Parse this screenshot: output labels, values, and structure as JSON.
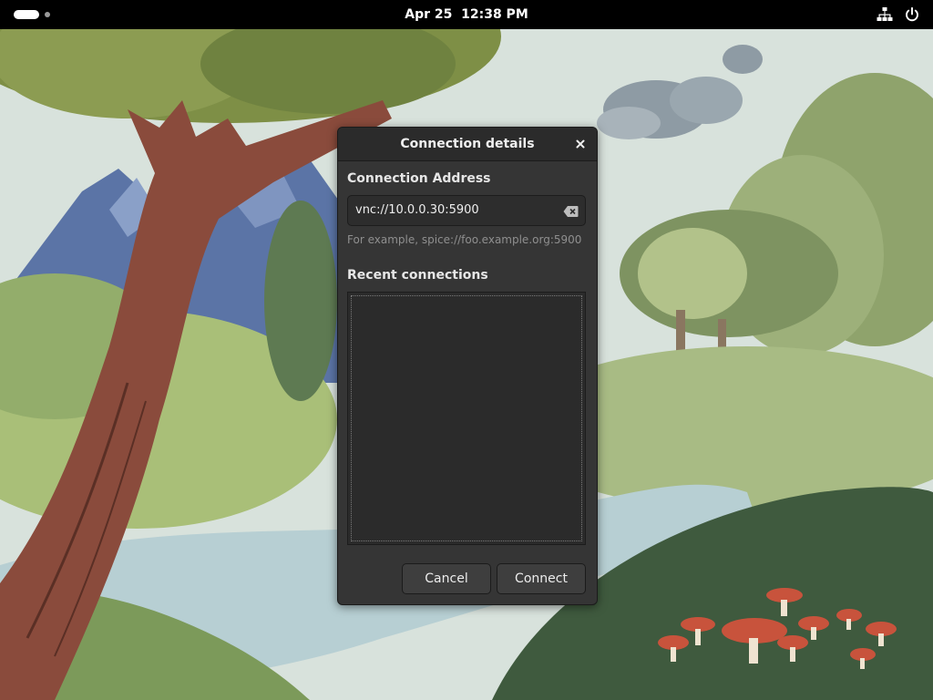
{
  "topbar": {
    "datetime": "Apr 25  12:38 PM",
    "icons": [
      "activities-indicator",
      "network-wired-icon",
      "power-icon"
    ]
  },
  "dialog": {
    "title": "Connection details",
    "address_label": "Connection Address",
    "address_value": "vnc://10.0.0.30:5900",
    "address_hint": "For example, spice://foo.example.org:5900",
    "recent_label": "Recent connections",
    "recent_connections": [],
    "cancel_label": "Cancel",
    "connect_label": "Connect"
  },
  "colors": {
    "dialog_bg": "#353535",
    "titlebar_bg": "#2b2b2b",
    "topbar_bg": "#000000"
  }
}
